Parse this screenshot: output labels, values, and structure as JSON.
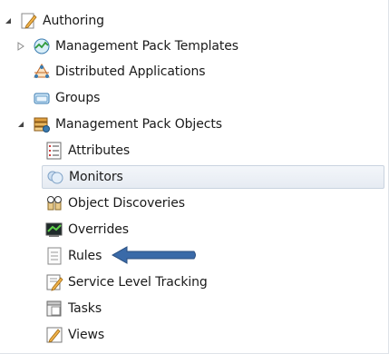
{
  "tree": {
    "authoring": {
      "label": "Authoring",
      "icon": "pencil-page-icon",
      "expanded": true
    },
    "mp_templates": {
      "label": "Management Pack Templates",
      "icon": "template-gauge-icon",
      "expanded": false
    },
    "distributed_apps": {
      "label": "Distributed Applications",
      "icon": "distributed-app-icon"
    },
    "groups": {
      "label": "Groups",
      "icon": "groups-icon"
    },
    "mp_objects": {
      "label": "Management Pack Objects",
      "icon": "mp-objects-icon",
      "expanded": true,
      "children": [
        {
          "label": "Attributes",
          "icon": "attributes-list-icon"
        },
        {
          "label": "Monitors",
          "icon": "monitors-icon",
          "selected": true
        },
        {
          "label": "Object Discoveries",
          "icon": "object-discoveries-icon"
        },
        {
          "label": "Overrides",
          "icon": "overrides-icon"
        },
        {
          "label": "Rules",
          "icon": "rules-icon"
        },
        {
          "label": "Service Level Tracking",
          "icon": "service-level-icon"
        },
        {
          "label": "Tasks",
          "icon": "tasks-icon"
        },
        {
          "label": "Views",
          "icon": "views-icon"
        }
      ]
    }
  },
  "colors": {
    "annotation_arrow": "#3a6aa8",
    "selection_border": "#c9d3df"
  }
}
